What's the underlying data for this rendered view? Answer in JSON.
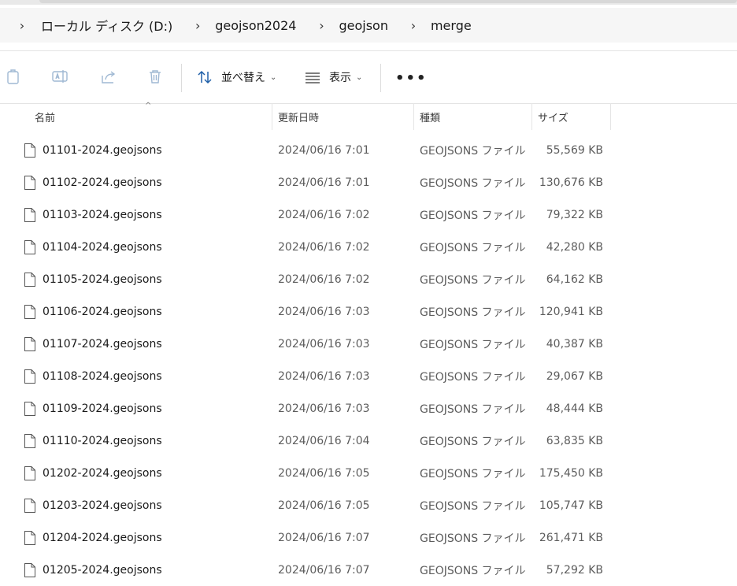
{
  "breadcrumb": {
    "items": [
      "ローカル ディスク (D:)",
      "geojson2024",
      "geojson",
      "merge"
    ]
  },
  "toolbar": {
    "sort_label": "並べ替え",
    "view_label": "表示",
    "more_label": "•••"
  },
  "columns": {
    "name": "名前",
    "date": "更新日時",
    "type": "種類",
    "size": "サイズ"
  },
  "files": [
    {
      "name": "01101-2024.geojsons",
      "date": "2024/06/16 7:01",
      "type": "GEOJSONS ファイル",
      "size": "55,569 KB"
    },
    {
      "name": "01102-2024.geojsons",
      "date": "2024/06/16 7:01",
      "type": "GEOJSONS ファイル",
      "size": "130,676 KB"
    },
    {
      "name": "01103-2024.geojsons",
      "date": "2024/06/16 7:02",
      "type": "GEOJSONS ファイル",
      "size": "79,322 KB"
    },
    {
      "name": "01104-2024.geojsons",
      "date": "2024/06/16 7:02",
      "type": "GEOJSONS ファイル",
      "size": "42,280 KB"
    },
    {
      "name": "01105-2024.geojsons",
      "date": "2024/06/16 7:02",
      "type": "GEOJSONS ファイル",
      "size": "64,162 KB"
    },
    {
      "name": "01106-2024.geojsons",
      "date": "2024/06/16 7:03",
      "type": "GEOJSONS ファイル",
      "size": "120,941 KB"
    },
    {
      "name": "01107-2024.geojsons",
      "date": "2024/06/16 7:03",
      "type": "GEOJSONS ファイル",
      "size": "40,387 KB"
    },
    {
      "name": "01108-2024.geojsons",
      "date": "2024/06/16 7:03",
      "type": "GEOJSONS ファイル",
      "size": "29,067 KB"
    },
    {
      "name": "01109-2024.geojsons",
      "date": "2024/06/16 7:03",
      "type": "GEOJSONS ファイル",
      "size": "48,444 KB"
    },
    {
      "name": "01110-2024.geojsons",
      "date": "2024/06/16 7:04",
      "type": "GEOJSONS ファイル",
      "size": "63,835 KB"
    },
    {
      "name": "01202-2024.geojsons",
      "date": "2024/06/16 7:05",
      "type": "GEOJSONS ファイル",
      "size": "175,450 KB"
    },
    {
      "name": "01203-2024.geojsons",
      "date": "2024/06/16 7:05",
      "type": "GEOJSONS ファイル",
      "size": "105,747 KB"
    },
    {
      "name": "01204-2024.geojsons",
      "date": "2024/06/16 7:07",
      "type": "GEOJSONS ファイル",
      "size": "261,471 KB"
    },
    {
      "name": "01205-2024.geojsons",
      "date": "2024/06/16 7:07",
      "type": "GEOJSONS ファイル",
      "size": "57,292 KB"
    }
  ],
  "icons": {
    "toolbar_disabled": [
      "copy-icon",
      "rename-icon",
      "share-icon",
      "delete-icon"
    ],
    "sort": "sort-arrows-icon",
    "view": "view-lines-icon",
    "file": "document-icon"
  },
  "colors": {
    "disabled_icon": "#9fb8d3",
    "accent": "#1f5fa8"
  }
}
